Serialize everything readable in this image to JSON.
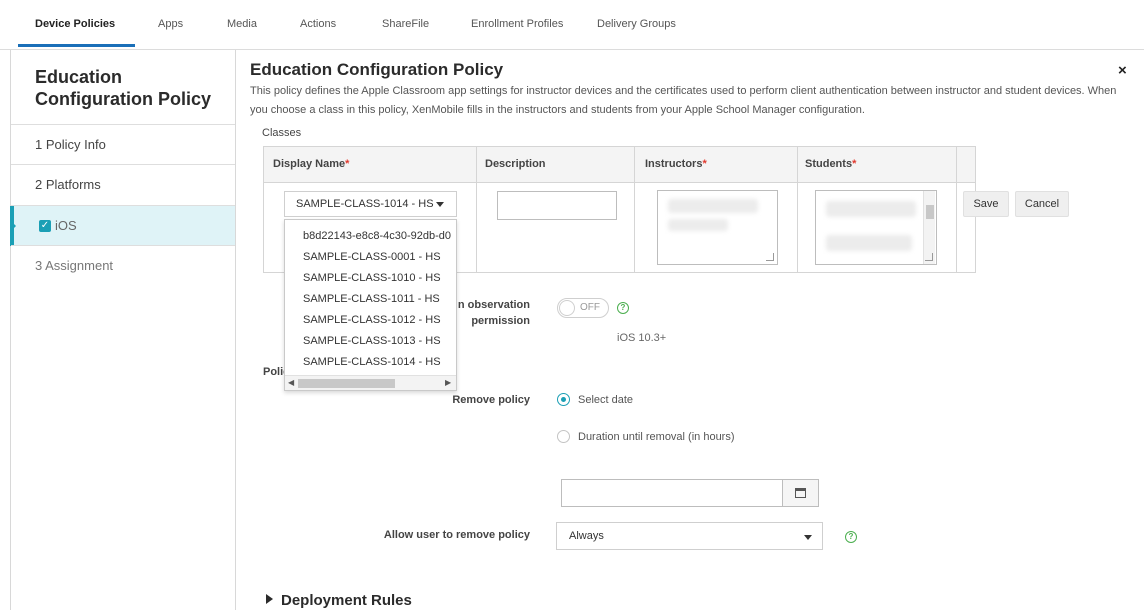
{
  "topnav": {
    "tabs": [
      "Device Policies",
      "Apps",
      "Media",
      "Actions",
      "ShareFile",
      "Enrollment Profiles",
      "Delivery Groups"
    ],
    "active": "Device Policies"
  },
  "sidebar": {
    "title": "Education Configuration Policy",
    "steps": [
      "1  Policy Info",
      "2  Platforms",
      "iOS",
      "3  Assignment"
    ]
  },
  "main": {
    "title": "Education Configuration Policy",
    "description": "This policy defines the Apple Classroom app settings for instructor devices and the certificates used to perform client authentication between instructor and student devices. When you choose a class in this policy, XenMobile fills in the instructors and students from your Apple School Manager configuration.",
    "classes_label": "Classes",
    "columns": [
      "Display Name",
      "Description",
      "Instructors",
      "Students"
    ],
    "required_mark": "*",
    "selected_class": "SAMPLE-CLASS-1014 - HS",
    "dropdown_options": [
      "b8d22143-e8c8-4c30-92db-d0",
      "SAMPLE-CLASS-0001 - HS",
      "SAMPLE-CLASS-1010 - HS",
      "SAMPLE-CLASS-1011 - HS",
      "SAMPLE-CLASS-1012 - HS",
      "SAMPLE-CLASS-1013 - HS",
      "SAMPLE-CLASS-1014 - HS"
    ],
    "save_label": "Save",
    "cancel_label": "Cancel",
    "observation_label_1": "n observation",
    "observation_label_2": "permission",
    "toggle_text": "OFF",
    "ios_version": "iOS 10.3+",
    "policy_partial": "Polic",
    "remove_policy_label": "Remove policy",
    "option_select_date": "Select date",
    "option_duration": "Duration until removal (in hours)",
    "allow_remove_label": "Allow user to remove policy",
    "allow_remove_value": "Always",
    "deployment_rules": "Deployment Rules",
    "close_icon": "×",
    "help_icon": "?"
  }
}
